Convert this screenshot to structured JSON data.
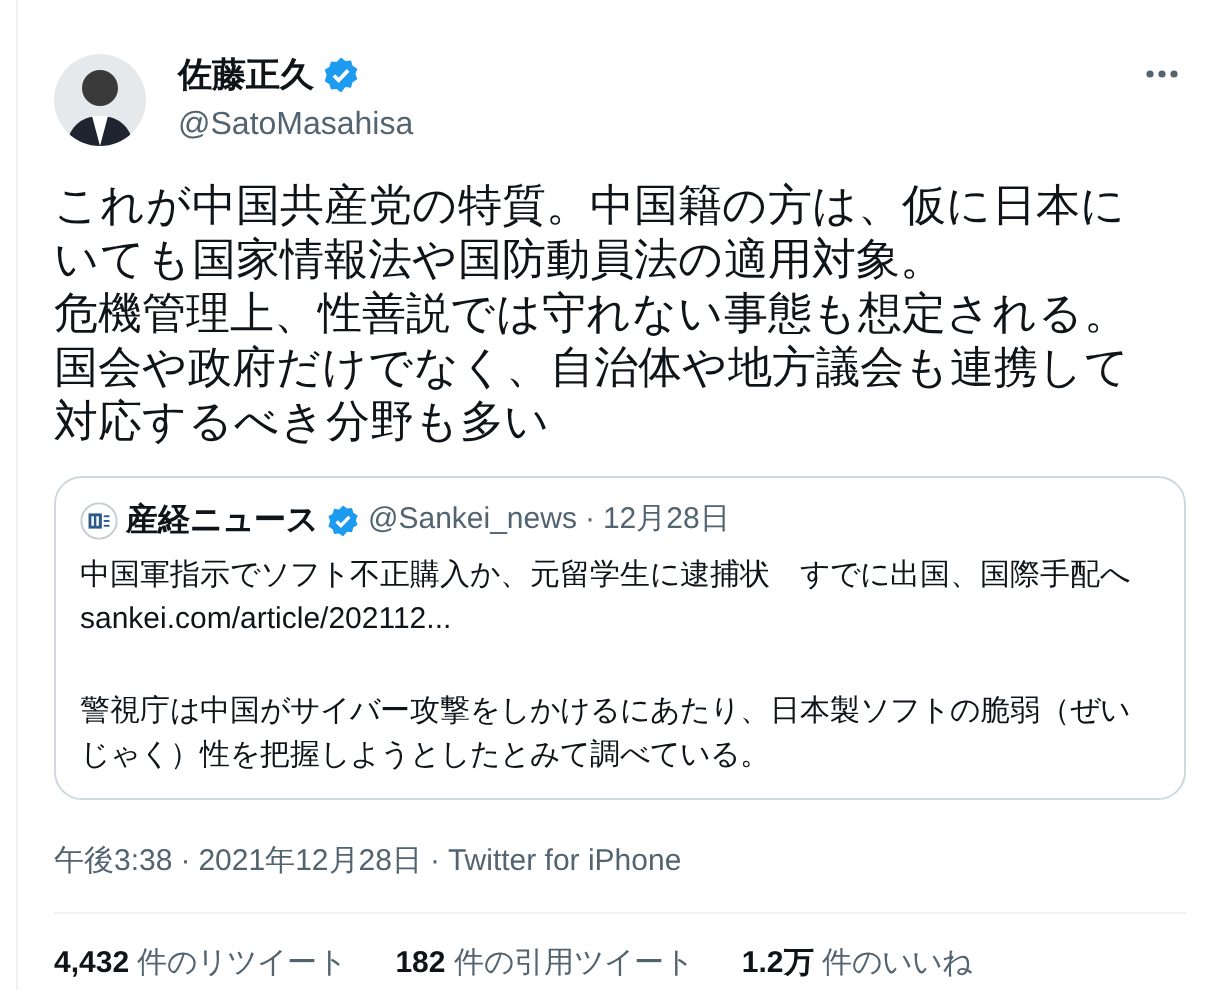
{
  "author": {
    "name": "佐藤正久",
    "verified": true,
    "handle": "@SatoMasahisa"
  },
  "tweet_text": [
    "これが中国共産党の特質。中国籍の方は、仮に日本にいても国家情報法や国防動員法の適用対象。",
    "危機管理上、性善説では守れない事態も想定される。",
    "国会や政府だけでなく、自治体や地方議会も連携して対応するべき分野も多い"
  ],
  "quote": {
    "name": "産経ニュース",
    "verified": true,
    "handle": "@Sankei_news",
    "separator": "·",
    "date": "12月28日",
    "headline": "中国軍指示でソフト不正購入か、元留学生に逮捕状　すでに出国、国際手配へ",
    "link": "sankei.com/article/202112...",
    "body": "警視庁は中国がサイバー攻撃をしかけるにあたり、日本製ソフトの脆弱（ぜいじゃく）性を把握しようとしたとみて調べている。"
  },
  "meta": [
    "午後3:38",
    "·",
    "2021年12月28日",
    "·",
    "Twitter for iPhone"
  ],
  "stats": [
    {
      "count": "4,432",
      "label": "件のリツイート"
    },
    {
      "count": "182",
      "label": "件の引用ツイート"
    },
    {
      "count": "1.2万",
      "label": "件のいいね"
    }
  ]
}
